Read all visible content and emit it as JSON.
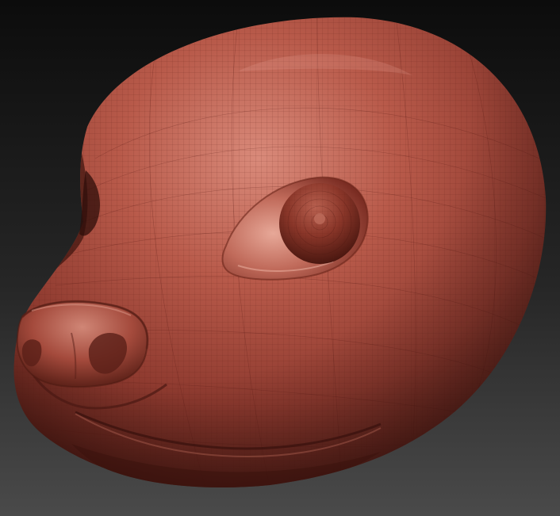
{
  "scene": {
    "subject": "sculpted-animal-head",
    "colors": {
      "background_top": "#0c0c0c",
      "background_bottom": "#4a4a4a",
      "clay_highlight": "#d98a7a",
      "clay_base": "#a8473a",
      "clay_mid": "#8e3a2f",
      "clay_shadow": "#5a1f18",
      "clay_deep": "#3a120d",
      "wire": "#5c1e16"
    }
  }
}
